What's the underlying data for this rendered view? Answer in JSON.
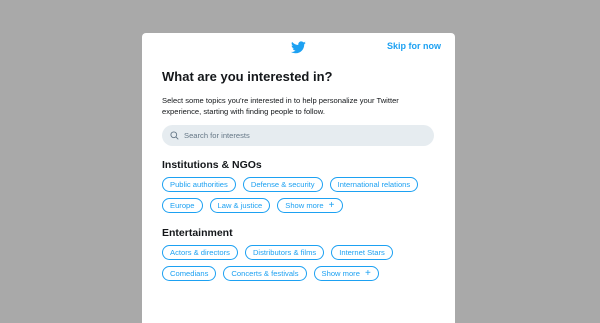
{
  "header": {
    "skip_label": "Skip for now",
    "logo_icon": "twitter-bird-icon"
  },
  "title": "What are you interested in?",
  "description": "Select some topics you're interested in to help personalize your Twitter experience, starting with finding people to follow.",
  "search": {
    "placeholder": "Search for interests",
    "icon": "search-icon"
  },
  "colors": {
    "accent": "#1da1f2",
    "backdrop": "#a9a9a9",
    "search_bg": "#e6ecf0"
  },
  "sections": [
    {
      "title": "Institutions & NGOs",
      "topics": [
        "Public authorities",
        "Defense & security",
        "International relations",
        "Europe",
        "Law & justice"
      ],
      "show_more": "Show more"
    },
    {
      "title": "Entertainment",
      "topics": [
        "Actors & directors",
        "Distributors & films",
        "Internet Stars",
        "Comedians",
        "Concerts & festivals"
      ],
      "show_more": "Show more"
    }
  ]
}
